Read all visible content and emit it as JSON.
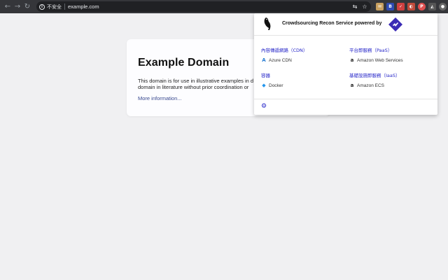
{
  "browser": {
    "security_label": "不安全",
    "url": "example.com"
  },
  "page": {
    "heading": "Example Domain",
    "paragraph_line1": "This domain is for use in illustrative examples in d",
    "paragraph_line2": "domain in literature without prior coordination or",
    "link": "More information..."
  },
  "popup": {
    "title": "Crowdsourcing Recon Service powered by",
    "items": [
      {
        "heading": "內容傳遞網路（CDN）",
        "value": "Azure CDN",
        "icon": "azure-icon"
      },
      {
        "heading": "平台即服務（PaaS）",
        "value": "Amazon Web Services",
        "icon": "amazon-icon"
      },
      {
        "heading": "容器",
        "value": "Docker",
        "icon": "docker-icon"
      },
      {
        "heading": "基礎設施即服務（IaaS）",
        "value": "Amazon ECS",
        "icon": "amazon-icon"
      }
    ]
  },
  "colors": {
    "toolbar": "#35363a",
    "accent_link": "#2323c8",
    "brand_purple": "#3b2bb5"
  }
}
